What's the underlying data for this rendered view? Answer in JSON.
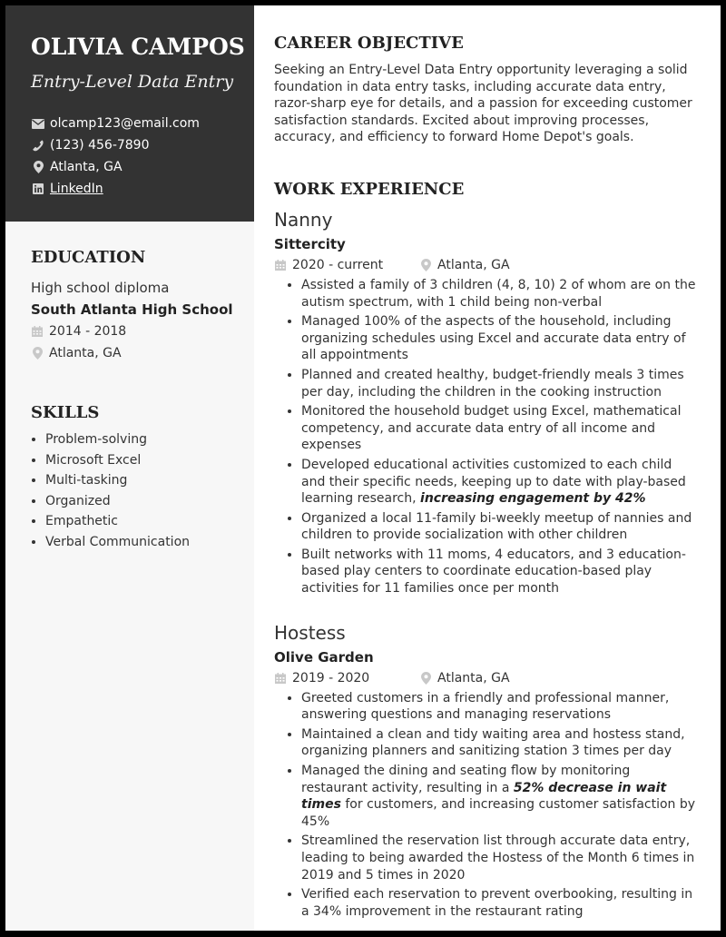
{
  "header": {
    "name": "OLIVIA CAMPOS",
    "title": "Entry-Level Data Entry",
    "contacts": [
      {
        "icon": "envelope-icon",
        "text": "olcamp123@email.com"
      },
      {
        "icon": "phone-icon",
        "text": "(123) 456-7890"
      },
      {
        "icon": "map-pin-icon",
        "text": "Atlanta, GA"
      },
      {
        "icon": "linkedin-icon",
        "text": "LinkedIn"
      }
    ]
  },
  "education": {
    "heading": "EDUCATION",
    "degree": "High school diploma",
    "school": "South Atlanta High School",
    "dates": "2014 - 2018",
    "location": "Atlanta, GA"
  },
  "skills": {
    "heading": "SKILLS",
    "items": [
      "Problem-solving",
      "Microsoft Excel",
      "Multi-tasking",
      "Organized",
      "Empathetic",
      "Verbal Communication"
    ]
  },
  "objective": {
    "heading": "CAREER OBJECTIVE",
    "text": "Seeking an Entry-Level Data Entry opportunity leveraging a solid foundation in data entry tasks, including accurate data entry, razor-sharp eye for details, and a passion for exceeding customer satisfaction standards. Excited about improving processes, accuracy, and efficiency to forward Home Depot's goals."
  },
  "work": {
    "heading": "WORK EXPERIENCE",
    "jobs": [
      {
        "title": "Nanny",
        "company": "Sittercity",
        "dates": "2020 - current",
        "location": "Atlanta, GA",
        "bullets": [
          {
            "pre": "Assisted a family of 3 children (4, 8, 10) 2 of whom are on the autism spectrum, with 1 child being non-verbal",
            "em": "",
            "post": ""
          },
          {
            "pre": "Managed 100% of the aspects of the household, including organizing schedules using Excel and accurate data entry of all appointments",
            "em": "",
            "post": ""
          },
          {
            "pre": "Planned and created healthy, budget-friendly meals 3 times per day, including the children in the cooking instruction",
            "em": "",
            "post": ""
          },
          {
            "pre": "Monitored the household budget using Excel, mathematical competency, and accurate data entry of all income and expenses",
            "em": "",
            "post": ""
          },
          {
            "pre": "Developed educational activities customized to each child and their specific needs, keeping up to date with play-based learning research, ",
            "em": "increasing engagement by 42%",
            "post": ""
          },
          {
            "pre": "Organized a local 11-family bi-weekly meetup of nannies and children to provide socialization with other children",
            "em": "",
            "post": ""
          },
          {
            "pre": "Built networks with 11 moms, 4 educators, and 3 education-based play centers to coordinate education-based play activities for 11 families once per month",
            "em": "",
            "post": ""
          }
        ]
      },
      {
        "title": "Hostess",
        "company": "Olive Garden",
        "dates": "2019 - 2020",
        "location": "Atlanta, GA",
        "bullets": [
          {
            "pre": "Greeted customers in a friendly and professional manner, answering questions and managing reservations",
            "em": "",
            "post": ""
          },
          {
            "pre": "Maintained a clean and tidy waiting area and hostess stand, organizing planners and sanitizing station 3 times per day",
            "em": "",
            "post": ""
          },
          {
            "pre": "Managed the dining and seating flow by monitoring restaurant activity, resulting in a ",
            "em": "52% decrease in wait times",
            "post": " for customers, and increasing customer satisfaction by 45%"
          },
          {
            "pre": "Streamlined the reservation list through accurate data entry, leading to being awarded the Hostess of the Month 6 times in 2019 and 5 times in 2020",
            "em": "",
            "post": ""
          },
          {
            "pre": "Verified each reservation to prevent overbooking, resulting in a 34% improvement in the restaurant rating",
            "em": "",
            "post": ""
          }
        ]
      }
    ]
  },
  "colors": {
    "header_bg": "#333333",
    "sidebar_bg": "#f7f7f7",
    "icon_gray": "#bbbbbb",
    "text": "#333333",
    "frame": "#000000"
  }
}
